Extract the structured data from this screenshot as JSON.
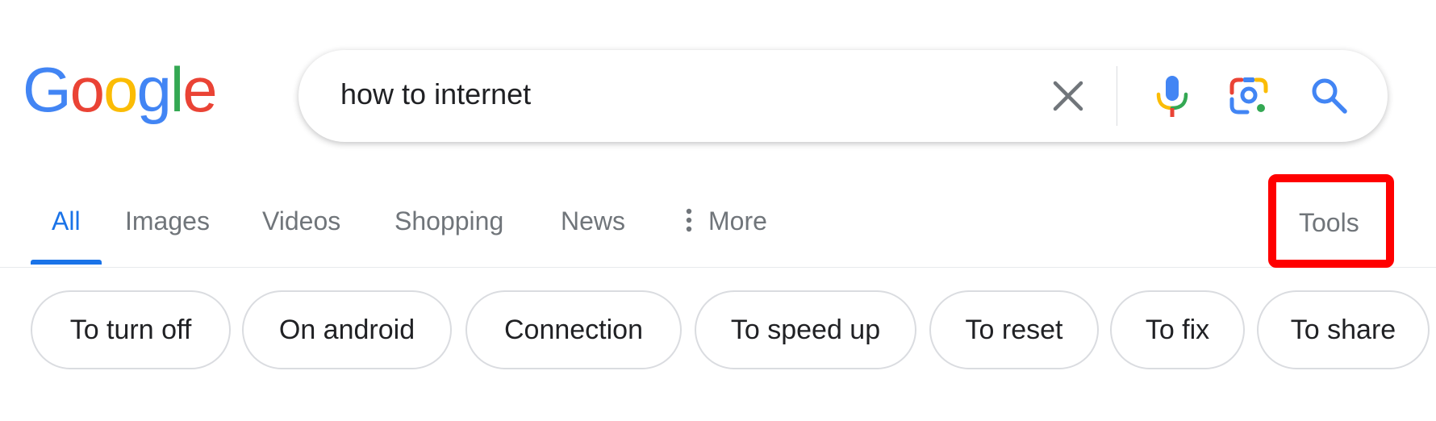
{
  "logo": {
    "letters": [
      "G",
      "o",
      "o",
      "g",
      "l",
      "e"
    ],
    "colors": [
      "#4285f4",
      "#ea4335",
      "#fbbc05",
      "#4285f4",
      "#34a853",
      "#ea4335"
    ]
  },
  "search": {
    "query": "how to internet",
    "clear_icon": "close-icon",
    "mic_icon": "microphone-icon",
    "lens_icon": "camera-lens-icon",
    "search_icon": "search-icon"
  },
  "tabs": [
    {
      "label": "All",
      "active": true
    },
    {
      "label": "Images"
    },
    {
      "label": "Videos"
    },
    {
      "label": "Shopping"
    },
    {
      "label": "News"
    },
    {
      "label": "More",
      "icon": "vertical-dots-icon"
    }
  ],
  "tools": {
    "label": "Tools",
    "highlight_color": "#ff0000"
  },
  "chips": [
    "To turn off",
    "On android",
    "Connection",
    "To speed up",
    "To reset",
    "To fix",
    "To share"
  ],
  "colors": {
    "accent": "#1a73e8",
    "tab_text": "#70757a",
    "text": "#202124",
    "border": "#dadce0"
  }
}
